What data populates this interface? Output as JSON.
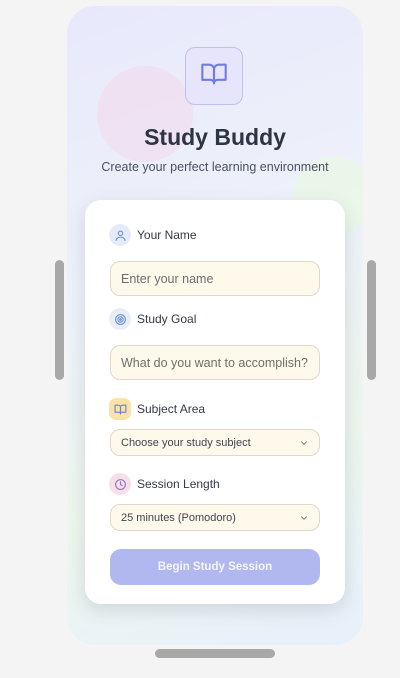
{
  "app": {
    "title": "Study Buddy",
    "subtitle": "Create your perfect learning environment",
    "logo_icon": "open-book-icon",
    "accent_color": "#7b86e0"
  },
  "form": {
    "name": {
      "label": "Your Name",
      "icon": "user-icon",
      "placeholder": "Enter your name",
      "value": ""
    },
    "goal": {
      "label": "Study Goal",
      "icon": "target-icon",
      "placeholder": "What do you want to accomplish?",
      "value": ""
    },
    "subject": {
      "label": "Subject Area",
      "icon": "book-icon",
      "selected": "Choose your study subject"
    },
    "session": {
      "label": "Session Length",
      "icon": "clock-icon",
      "selected": "25 minutes (Pomodoro)"
    },
    "submit_label": "Begin Study Session"
  }
}
